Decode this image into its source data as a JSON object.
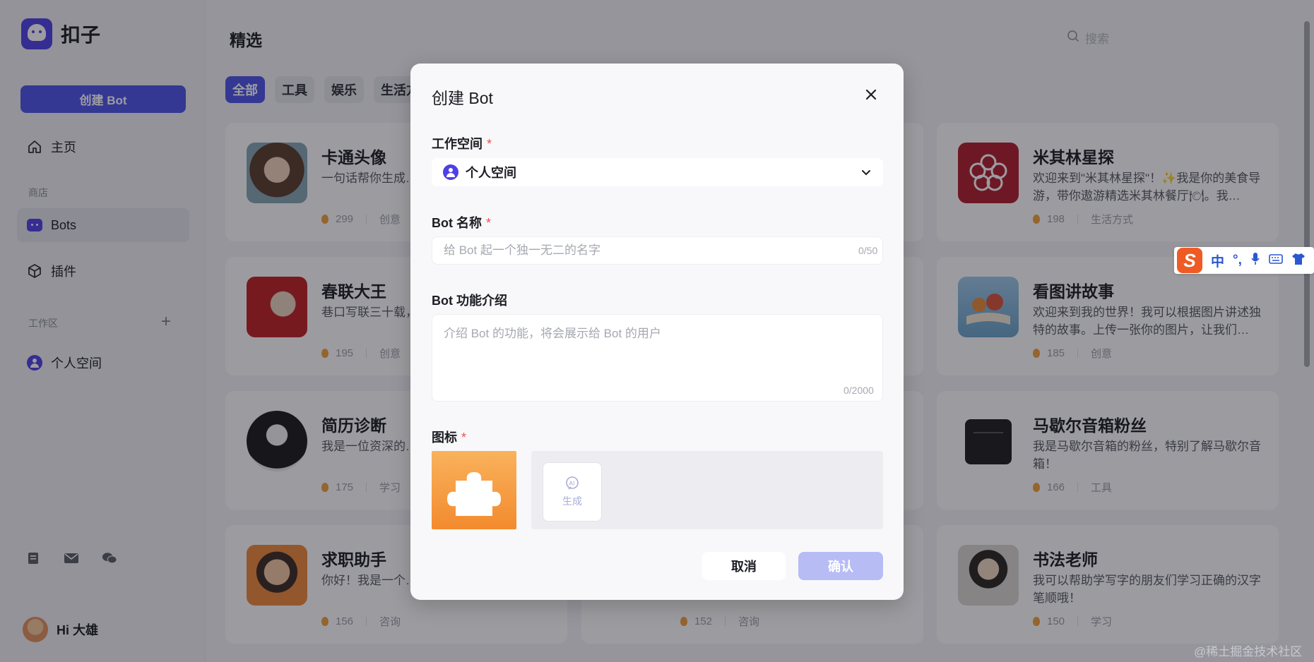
{
  "app": {
    "logo_text": "扣子",
    "create_button": "创建 Bot"
  },
  "sidebar": {
    "home": "主页",
    "store_label": "商店",
    "bots": "Bots",
    "plugins": "插件",
    "workspace_label": "工作区",
    "workspace_add": "+",
    "personal_space": "个人空间",
    "user_greeting": "Hi 大雄"
  },
  "main": {
    "title": "精选",
    "search_placeholder": "搜索",
    "tabs": [
      {
        "label": "全部",
        "active": true
      },
      {
        "label": "工具"
      },
      {
        "label": "娱乐"
      },
      {
        "label": "生活方"
      }
    ]
  },
  "cards": [
    {
      "name": "卡通头像",
      "desc": "一句话帮你生成…",
      "count": "299",
      "category": "创意"
    },
    {
      "name": "春联大王",
      "desc": "巷口写联三十载，大王王师傅，对…",
      "count": "195",
      "category": "创意"
    },
    {
      "name": "简历诊断",
      "desc": "我是一位资深的…你解析简历内容…",
      "count": "175",
      "category": "学习"
    },
    {
      "name": "求职助手",
      "desc": "你好！我是一个…的需求和情况，…",
      "count": "156",
      "category": "咨询"
    },
    {
      "name": "米其林星探",
      "desc": "欢迎来到\"米其林星探\"！✨我是你的美食导游，带你遨游精选米其林餐厅🍽。我…",
      "count": "198",
      "category": "生活方式"
    },
    {
      "name": "看图讲故事",
      "desc": "欢迎来到我的世界！我可以根据图片讲述独特的故事。上传一张你的图片，让我们…",
      "count": "185",
      "category": "创意"
    },
    {
      "name": "马歇尔音箱粉丝",
      "desc": "我是马歇尔音箱的粉丝，特别了解马歇尔音箱！",
      "count": "166",
      "category": "工具"
    },
    {
      "name": "书法老师",
      "desc": "我可以帮助学写字的朋友们学习正确的汉字笔顺哦！",
      "count": "150",
      "category": "学习"
    }
  ],
  "hidden_card_meta": {
    "count": "152",
    "category": "咨询"
  },
  "modal": {
    "title": "创建 Bot",
    "workspace_label": "工作空间",
    "required_mark": "*",
    "workspace_value": "个人空间",
    "name_label": "Bot 名称",
    "name_placeholder": "给 Bot 起一个独一无二的名字",
    "name_counter": "0/50",
    "desc_label": "Bot 功能介绍",
    "desc_placeholder": "介绍 Bot 的功能，将会展示给 Bot 的用户",
    "desc_counter": "0/2000",
    "icon_label": "图标",
    "generate_label": "生成",
    "cancel": "取消",
    "confirm": "确认"
  },
  "ime": {
    "mode": "中",
    "punct": "°,"
  },
  "watermark": "@稀土掘金技术社区",
  "colors": {
    "brand": "#4d53e8",
    "confirm_disabled": "#b7bcf5",
    "required": "#f04d4d"
  }
}
